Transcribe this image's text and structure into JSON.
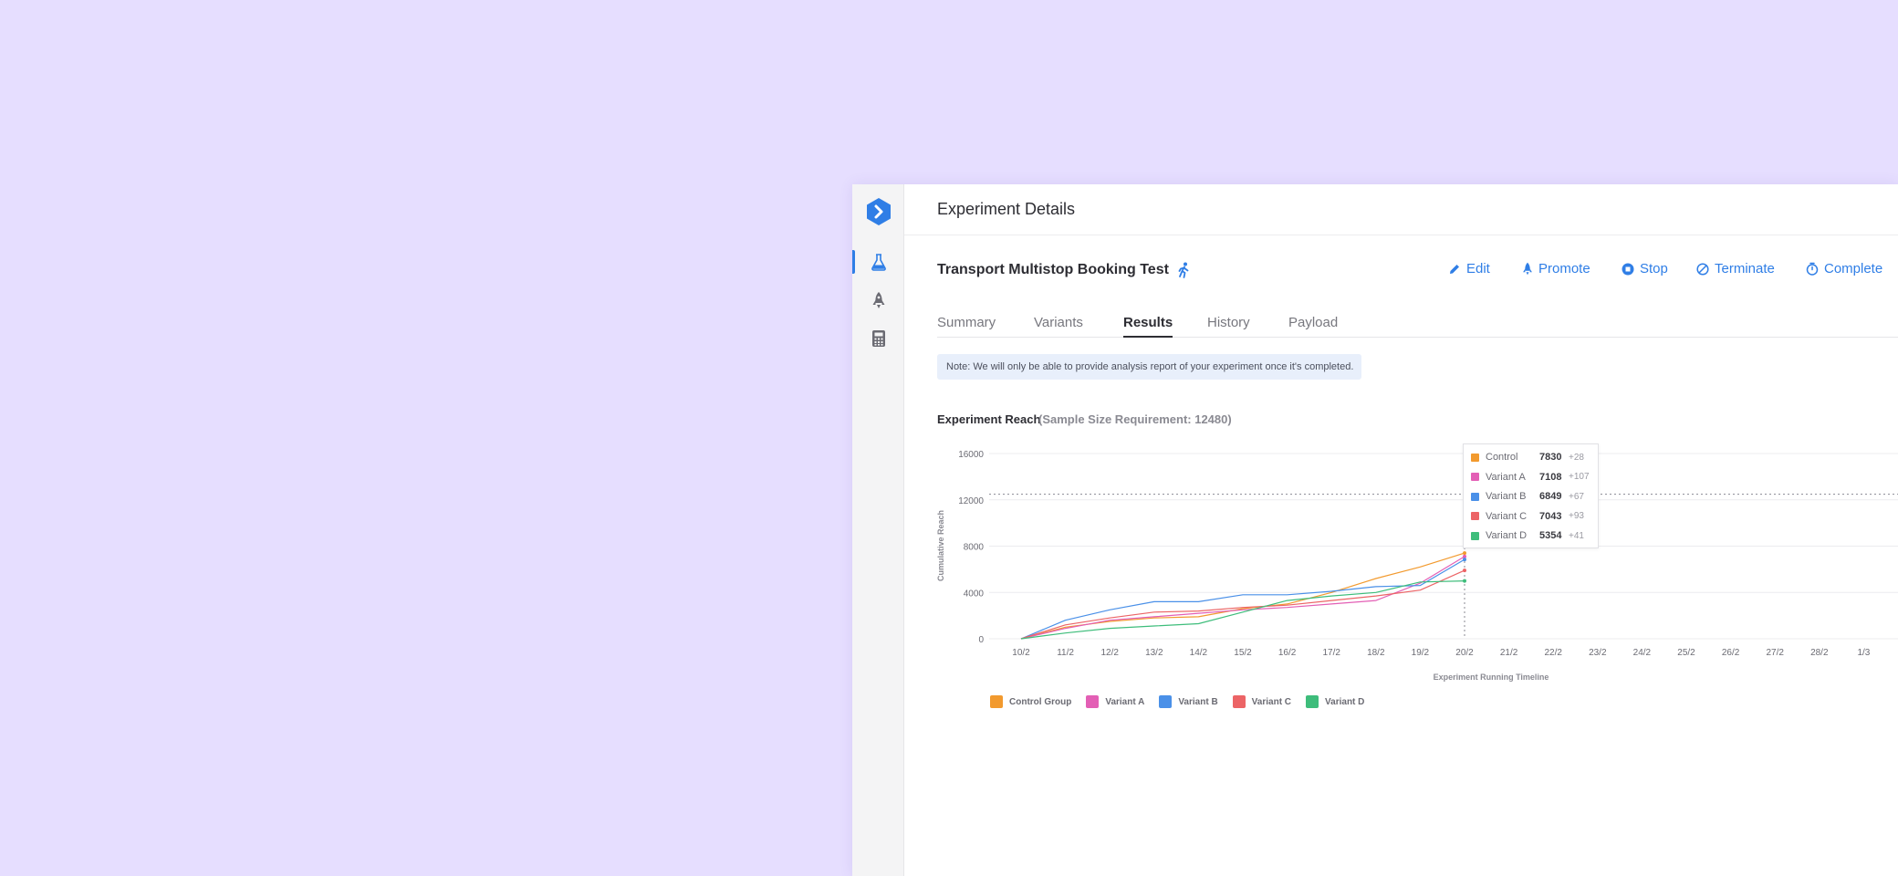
{
  "header": {
    "title": "Experiment Details"
  },
  "rail": {
    "items": [
      "flask-icon",
      "rocket-icon",
      "calculator-icon"
    ],
    "active": "flask-icon"
  },
  "experiment": {
    "title": "Transport Multistop Booking Test"
  },
  "actions": [
    {
      "label": "Edit",
      "icon": "pencil-icon"
    },
    {
      "label": "Promote",
      "icon": "rocket-icon"
    },
    {
      "label": "Stop",
      "icon": "stop-icon"
    },
    {
      "label": "Terminate",
      "icon": "ban-icon"
    },
    {
      "label": "Complete",
      "icon": "stopwatch-icon"
    }
  ],
  "tabs": [
    "Summary",
    "Variants",
    "Results",
    "History",
    "Payload"
  ],
  "active_tab": "Results",
  "note": "Note: We will only be able to provide analysis report of your experiment once it's completed.",
  "reach": {
    "title": "Experiment Reach",
    "requirement": "(Sample Size Requirement: 12480)"
  },
  "colors": {
    "accent": "#2f7ee6",
    "control": "#f29a2e",
    "variant_a": "#e35fb5",
    "variant_b": "#4a90e8",
    "variant_c": "#ec6466",
    "variant_d": "#3ebd7b"
  },
  "tooltip": [
    {
      "name": "Control",
      "value": "7830",
      "delta": "+28",
      "color": "#f29a2e"
    },
    {
      "name": "Variant A",
      "value": "7108",
      "delta": "+107",
      "color": "#e35fb5"
    },
    {
      "name": "Variant B",
      "value": "6849",
      "delta": "+67",
      "color": "#4a90e8"
    },
    {
      "name": "Variant C",
      "value": "7043",
      "delta": "+93",
      "color": "#ec6466"
    },
    {
      "name": "Variant D",
      "value": "5354",
      "delta": "+41",
      "color": "#3ebd7b"
    }
  ],
  "chart_data": {
    "type": "line",
    "xlabel": "Experiment Running Timeline",
    "ylabel": "Cumulative Reach",
    "categories": [
      "10/2",
      "11/2",
      "12/2",
      "13/2",
      "14/2",
      "15/2",
      "16/2",
      "17/2",
      "18/2",
      "19/2",
      "20/2",
      "21/2",
      "22/2",
      "23/2",
      "24/2",
      "25/2",
      "26/2",
      "27/2",
      "28/2",
      "1/3"
    ],
    "yticks": [
      "0",
      "4000",
      "8000",
      "12000",
      "16000"
    ],
    "ylim": [
      0,
      16000
    ],
    "reference_line": 12480,
    "grid": true,
    "legend_position": "bottom-left",
    "hover_category": "20/2",
    "series": [
      {
        "name": "Control Group",
        "color": "#f29a2e",
        "values": [
          0,
          1000,
          1500,
          1800,
          1900,
          2600,
          3000,
          4000,
          5200,
          6200,
          7400
        ]
      },
      {
        "name": "Variant A",
        "color": "#e35fb5",
        "values": [
          0,
          900,
          1600,
          1900,
          2200,
          2500,
          2700,
          3000,
          3300,
          4800,
          7100
        ]
      },
      {
        "name": "Variant B",
        "color": "#4a90e8",
        "values": [
          0,
          1600,
          2500,
          3200,
          3200,
          3800,
          3800,
          4100,
          4500,
          4600,
          6849
        ]
      },
      {
        "name": "Variant C",
        "color": "#ec6466",
        "values": [
          0,
          1200,
          1800,
          2300,
          2400,
          2700,
          2900,
          3300,
          3700,
          4200,
          5900
        ]
      },
      {
        "name": "Variant D",
        "color": "#3ebd7b",
        "values": [
          0,
          500,
          900,
          1100,
          1300,
          2300,
          3300,
          3700,
          4000,
          4900,
          5000
        ]
      }
    ]
  }
}
